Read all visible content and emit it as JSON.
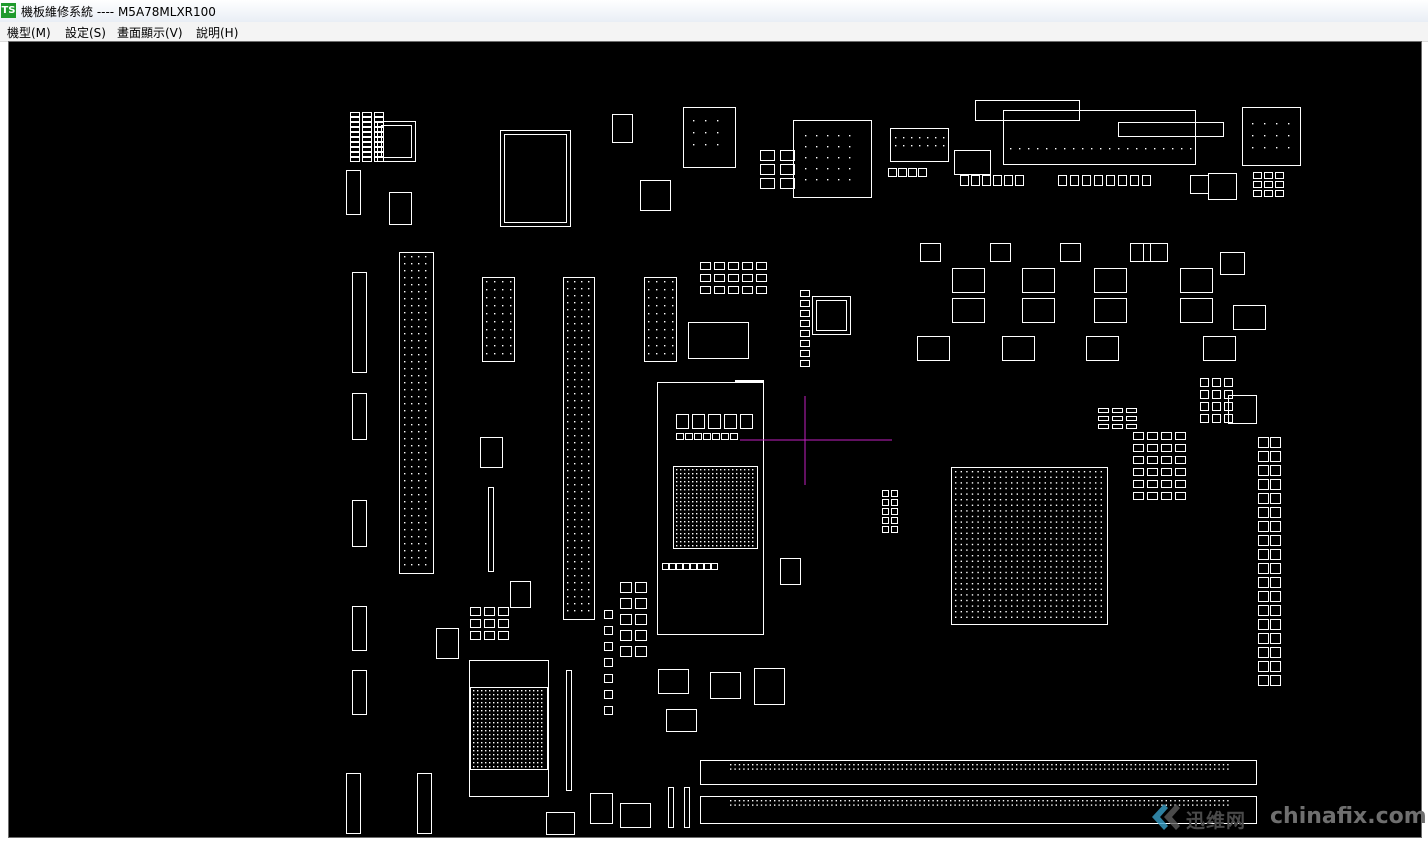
{
  "window": {
    "title": "機板維修系統 ---- M5A78MLXR100"
  },
  "app_logo": "TS",
  "menu": {
    "items": [
      {
        "label": "機型(M)"
      },
      {
        "label": "設定(S)"
      },
      {
        "label": "畫面顯示(V)"
      },
      {
        "label": "說明(H)"
      }
    ]
  },
  "canvas": {
    "background_color": "#000000",
    "component_outline_color": "#ffffff",
    "crosshair_color": "#c21fbf"
  },
  "watermark": {
    "cn": "迅维网",
    "domain": "chinafix.com"
  }
}
